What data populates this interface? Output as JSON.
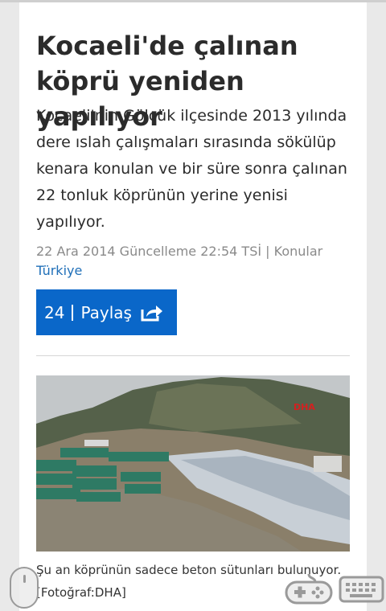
{
  "article": {
    "title": "Kocaeli'de çalınan köprü yeniden yapılıyor",
    "lead": "Kocaeli'nin Gölcük ilçesinde 2013 yılında dere ıslah çalışmaları sırasında sökülüp kenara konulan ve bir süre sonra çalınan 22 tonluk köprünün yerine yenisi yapılıyor.",
    "meta_text": "22 Ara 2014 Güncelleme 22:54 TSİ | Konular",
    "topic_link": "Türkiye",
    "share_count": "24",
    "share_label": "Paylaş",
    "photo_watermark": "DHA",
    "caption": "Şu an köprünün sadece beton sütunları bulunuyor. [Fotoğraf:DHA]"
  },
  "colors": {
    "accent": "#0a67c9",
    "link": "#1f6fb8"
  },
  "overlay": {
    "icons": [
      "mouse-icon",
      "gamepad-icon",
      "keyboard-icon"
    ]
  }
}
